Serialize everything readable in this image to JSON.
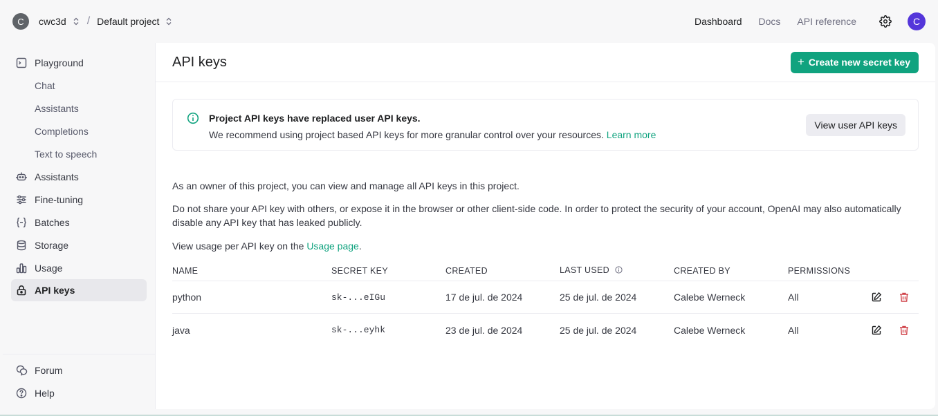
{
  "topbar": {
    "org_initial": "C",
    "org_name": "cwc3d",
    "separator": "/",
    "project_name": "Default project",
    "nav": [
      {
        "label": "Dashboard",
        "active": true
      },
      {
        "label": "Docs",
        "active": false
      },
      {
        "label": "API reference",
        "active": false
      }
    ],
    "settings_icon": "gear-icon",
    "user_initial": "C",
    "user_avatar_color": "#5436da"
  },
  "sidebar": {
    "items": [
      {
        "label": "Playground",
        "icon": "terminal-icon"
      },
      {
        "label": "Chat",
        "sub": true
      },
      {
        "label": "Assistants",
        "sub": true
      },
      {
        "label": "Completions",
        "sub": true
      },
      {
        "label": "Text to speech",
        "sub": true
      },
      {
        "label": "Assistants",
        "icon": "robot-icon"
      },
      {
        "label": "Fine-tuning",
        "icon": "sliders-icon"
      },
      {
        "label": "Batches",
        "icon": "braces-icon"
      },
      {
        "label": "Storage",
        "icon": "database-icon"
      },
      {
        "label": "Usage",
        "icon": "bar-chart-icon"
      },
      {
        "label": "API keys",
        "icon": "lock-icon",
        "active": true
      }
    ],
    "footer": [
      {
        "label": "Forum",
        "icon": "chat-bubbles-icon"
      },
      {
        "label": "Help",
        "icon": "help-circle-icon"
      }
    ]
  },
  "main": {
    "title": "API keys",
    "create_button": "Create new secret key",
    "notice": {
      "title": "Project API keys have replaced user API keys.",
      "body": "We recommend using project based API keys for more granular control over your resources.",
      "link": "Learn more",
      "button": "View user API keys"
    },
    "paragraph1": "As an owner of this project, you can view and manage all API keys in this project.",
    "paragraph2": "Do not share your API key with others, or expose it in the browser or other client-side code. In order to protect the security of your account, OpenAI may also automatically disable any API key that has leaked publicly.",
    "paragraph3_prefix": "View usage per API key on the ",
    "paragraph3_link": "Usage page",
    "paragraph3_suffix": ".",
    "table": {
      "headers": [
        "NAME",
        "SECRET KEY",
        "CREATED",
        "LAST USED",
        "CREATED BY",
        "PERMISSIONS"
      ],
      "rows": [
        {
          "name": "python",
          "key": "sk-...eIGu",
          "created": "17 de jul. de 2024",
          "last_used": "25 de jul. de 2024",
          "created_by": "Calebe Werneck",
          "permissions": "All"
        },
        {
          "name": "java",
          "key": "sk-...eyhk",
          "created": "23 de jul. de 2024",
          "last_used": "25 de jul. de 2024",
          "created_by": "Calebe Werneck",
          "permissions": "All"
        }
      ]
    }
  },
  "colors": {
    "accent": "#10a37f",
    "delete": "#d0434a"
  }
}
